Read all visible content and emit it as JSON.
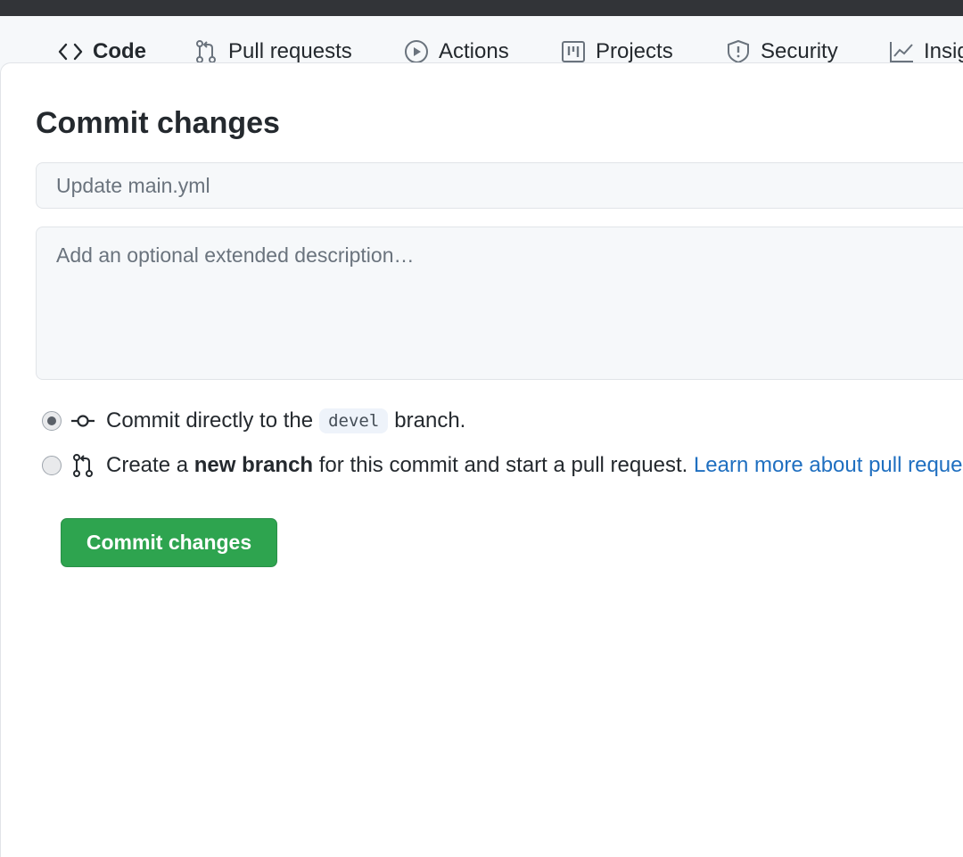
{
  "repo_nav": {
    "tabs": [
      {
        "label": "Code",
        "icon": "code-icon",
        "selected": true
      },
      {
        "label": "Pull requests",
        "icon": "git-pull-request-icon",
        "selected": false
      },
      {
        "label": "Actions",
        "icon": "play-icon",
        "selected": false
      },
      {
        "label": "Projects",
        "icon": "project-icon",
        "selected": false
      },
      {
        "label": "Security",
        "icon": "shield-icon",
        "selected": false
      },
      {
        "label": "Insights",
        "icon": "graph-icon",
        "selected": false
      }
    ]
  },
  "commit_dialog": {
    "title": "Commit changes",
    "summary_placeholder": "Update main.yml",
    "summary_value": "",
    "description_placeholder": "Add an optional extended description…",
    "description_value": "",
    "option_direct": {
      "prefix": "Commit directly to the",
      "branch": "devel",
      "suffix": "branch.",
      "checked": true,
      "icon": "git-commit-icon"
    },
    "option_new_branch": {
      "prefix": "Create a",
      "emphasis": "new branch",
      "suffix": "for this commit and start a pull request.",
      "link": "Learn more about pull requests.",
      "checked": false,
      "icon": "git-pull-request-icon"
    },
    "submit_label": "Commit changes"
  },
  "colors": {
    "primary_button": "#2ea44f",
    "link": "#1f6fc0",
    "topbar": "#323438"
  }
}
